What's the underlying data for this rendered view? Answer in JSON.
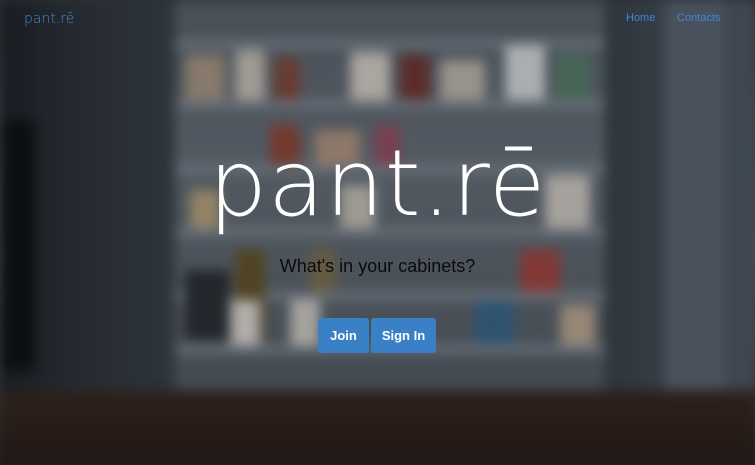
{
  "navbar": {
    "brand": "pant.rē",
    "links": [
      {
        "label": "Home"
      },
      {
        "label": "Contacts"
      }
    ]
  },
  "hero": {
    "logo": "pant.rē",
    "tagline": "What's in your cabinets?",
    "buttons": {
      "join": "Join",
      "sign_in": "Sign In"
    }
  },
  "colors": {
    "link": "#3f87d6",
    "button": "#3a80c6",
    "logo": "#ffffff",
    "tagline": "#0b0b0b"
  }
}
